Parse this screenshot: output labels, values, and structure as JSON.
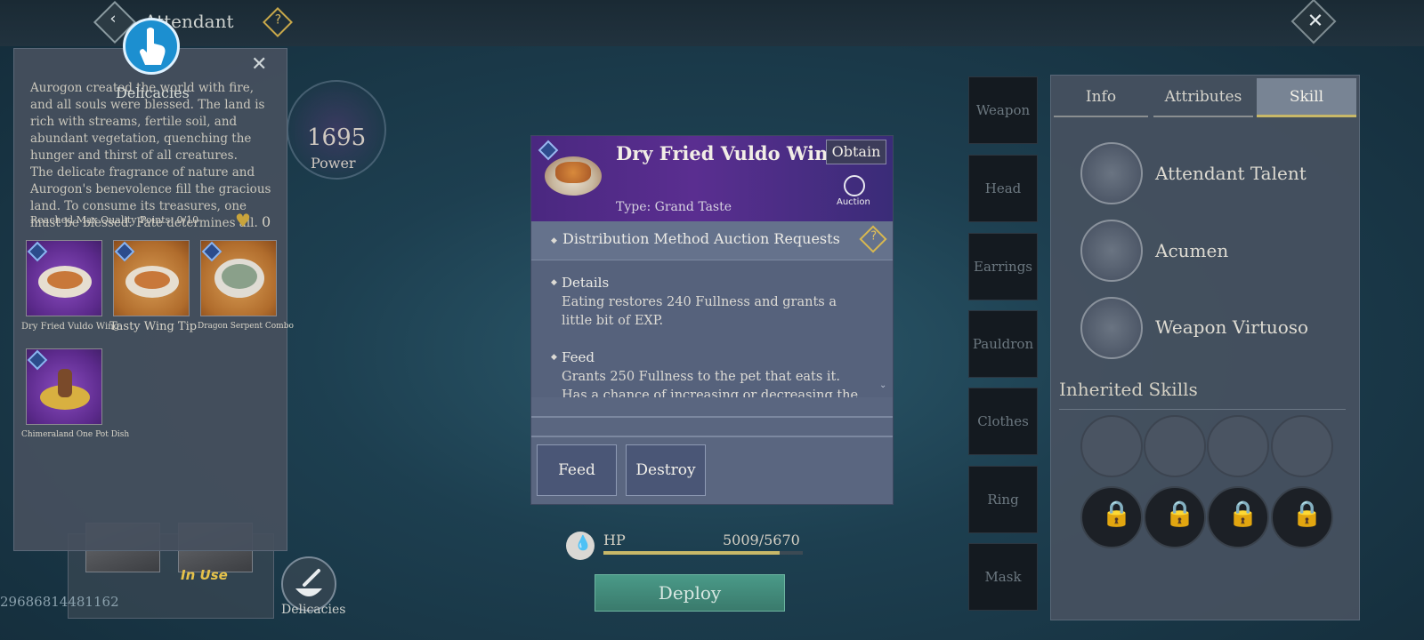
{
  "header": {
    "title": "Attendant",
    "back_icon": "‹",
    "help_icon": "?",
    "close_icon": "✕"
  },
  "delicacies_panel": {
    "title": "Delicacies",
    "close_icon": "✕",
    "description_1": "Aurogon created the world with fire, and all souls were blessed. The land is rich with streams, fertile soil, and abundant vegetation, quenching the hunger and thirst of all creatures.",
    "description_2": "The delicate fragrance of nature and Aurogon's benevolence fill the gracious land. To consume its treasures, one must be blessed. Fate determines all.",
    "quality_label": "Reached Max Quality Points: 0/10",
    "heart_icon": "♥",
    "heart_count": "0",
    "items": [
      {
        "name": "Dry Fried Vuldo Wing",
        "tile": "purple"
      },
      {
        "name": "Tasty Wing Tip",
        "tile": "orange"
      },
      {
        "name": "Dragon Serpent Combo",
        "tile": "orange"
      },
      {
        "name": "Chimeraland One Pot Dish",
        "tile": "purple"
      }
    ]
  },
  "power": {
    "value": "1695",
    "label": "Power"
  },
  "pets": {
    "in_use_label": "In Use"
  },
  "bottom_left": {
    "delicacies_label": "Delicacies",
    "uid": "29686814481162"
  },
  "popup": {
    "item_name": "Dry Fried Vuldo Wing",
    "obtain_label": "Obtain",
    "type_text": "Type: Grand Taste",
    "auction_label": "Auction",
    "distribution_label": "Distribution Method",
    "auction_requests_label": "Auction Requests",
    "details_heading": "Details",
    "details_text": "Eating restores 240 Fullness and grants a little bit of EXP.",
    "feed_heading": "Feed",
    "feed_text": "Grants 250 Fullness to the pet that eats it. Has a chance of increasing or decreasing the pet's",
    "scroll_icon": "⌄",
    "feed_button": "Feed",
    "destroy_button": "Destroy"
  },
  "hp": {
    "label": "HP",
    "value": "5009/5670",
    "fraction": 0.883
  },
  "deploy_label": "Deploy",
  "equipment_slots": [
    "Weapon",
    "Head",
    "Earrings",
    "Pauldron",
    "Clothes",
    "Ring",
    "Mask"
  ],
  "right_panel": {
    "tabs": [
      "Info",
      "Attributes",
      "Skill"
    ],
    "active_tab": "Skill",
    "skills": [
      "Attendant Talent",
      "Acumen",
      "Weapon Virtuoso"
    ],
    "inherited_title": "Inherited Skills",
    "lock_icon": "🔒"
  },
  "colors": {
    "accent_gold": "#c8b868",
    "deploy_green": "#4a9a88",
    "rarity_purple": "#5a2e90"
  }
}
